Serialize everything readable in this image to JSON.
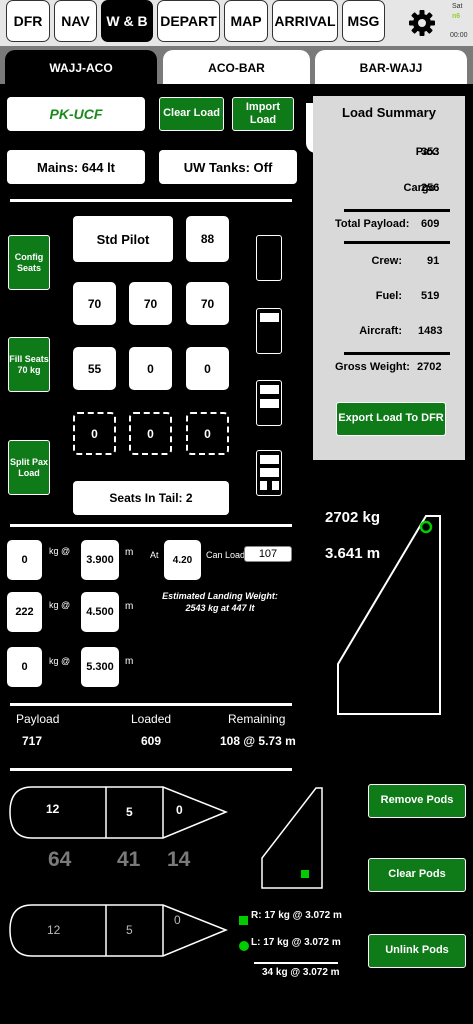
{
  "nav": {
    "tabs": [
      "DFR",
      "NAV",
      "W & B",
      "DEPART",
      "MAP",
      "ARRIVAL",
      "MSG"
    ],
    "active": "W & B",
    "sat_label": "Sat",
    "sat_status": "n6",
    "clock": "00:00"
  },
  "legs": {
    "tabs": [
      "WAJJ-ACO",
      "ACO-BAR",
      "BAR-WAJJ"
    ],
    "active": "WAJJ-ACO"
  },
  "aircraft": {
    "registration": "PK-UCF",
    "mains": "Mains: 644 lt",
    "uw_tanks": "UW Tanks: Off"
  },
  "buttons": {
    "clear_load": "Clear Load",
    "import_load": "Import Load",
    "config_seats": "Config Seats",
    "fill_seats": "Fill Seats 70 kg",
    "split_pax": "Split Pax Load",
    "export": "Export Load To DFR",
    "remove_pods": "Remove Pods",
    "clear_pods": "Clear Pods",
    "unlink_pods": "Unlink Pods"
  },
  "seats": {
    "pilot": "Std Pilot",
    "pilot_weight": "88",
    "row2": [
      "70",
      "70",
      "70"
    ],
    "row3": [
      "55",
      "0",
      "0"
    ],
    "row4": [
      "0",
      "0",
      "0"
    ],
    "tail": "Seats In Tail: 2"
  },
  "summary": {
    "title": "Load Summary",
    "rows": [
      {
        "label": "Pax:",
        "value": "353"
      },
      {
        "label": "Cargo:",
        "value": "256"
      },
      {
        "label": "Total Payload:",
        "value": "609"
      },
      {
        "label": "Crew:",
        "value": "91"
      },
      {
        "label": "Fuel:",
        "value": "519"
      },
      {
        "label": "Aircraft:",
        "value": "1483"
      },
      {
        "label": "Gross Weight:",
        "value": "2702"
      }
    ]
  },
  "cargo": {
    "rows": [
      {
        "kg": "0",
        "arm": "3.900"
      },
      {
        "kg": "222",
        "arm": "4.500"
      },
      {
        "kg": "0",
        "arm": "5.300"
      }
    ],
    "kg_at": "kg @",
    "unit_m": "m",
    "at_label": "At",
    "at_value": "4.20",
    "can_load_label": "Can Load",
    "can_load_value": "107",
    "landing_line1": "Estimated Landing Weight:",
    "landing_line2": "2543 kg at 447 lt"
  },
  "cg": {
    "weight": "2702 kg",
    "arm": "3.641 m"
  },
  "totals": {
    "payload_label": "Payload",
    "payload_value": "717",
    "loaded_label": "Loaded",
    "loaded_value": "609",
    "remaining_label": "Remaining",
    "remaining_value": "108 @ 5.73 m"
  },
  "pods": {
    "upper": [
      "12",
      "5",
      "0"
    ],
    "capacity": [
      "64",
      "41",
      "14"
    ],
    "lower": [
      "12",
      "5",
      "0"
    ],
    "right": "R: 17 kg @ 3.072 m",
    "left": "L: 17 kg @ 3.072 m",
    "total": "34 kg @ 3.072 m"
  },
  "colors": {
    "green": "#0f7a18",
    "reg_green": "#1a8a1a",
    "indicator": "#00cc00",
    "summary_bg": "#d9d9d9"
  }
}
